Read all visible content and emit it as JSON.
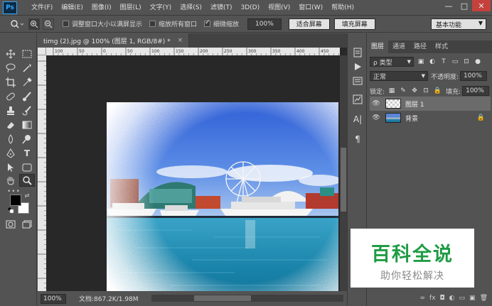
{
  "app": {
    "logo": "Ps"
  },
  "menu": [
    "文件(F)",
    "编辑(E)",
    "图像(I)",
    "图层(L)",
    "文字(Y)",
    "选择(S)",
    "滤镜(T)",
    "3D(D)",
    "视图(V)",
    "窗口(W)",
    "帮助(H)"
  ],
  "window_controls": {
    "minimize": "—",
    "maximize": "□",
    "close": "✕"
  },
  "options": {
    "tool_icon": "zoom-icon",
    "resize_windows": "调整窗口大小以满屏显示",
    "resize_windows_checked": false,
    "zoom_all": "缩放所有窗口",
    "zoom_all_checked": false,
    "scrubby": "细微缩放",
    "scrubby_checked": true,
    "zoom_value": "100%",
    "fit_screen": "适合屏幕",
    "fill_screen": "填充屏幕",
    "workspace": "基本功能"
  },
  "document": {
    "tab_title": "timg (2).jpg @ 100% (图层 1, RGB/8#) *",
    "close": "×",
    "ruler_ticks": [
      "100",
      "50",
      "0",
      "50",
      "100",
      "150",
      "200",
      "250",
      "300",
      "350",
      "400",
      "450"
    ],
    "status_zoom": "100%",
    "status_info": "文档:867.2K/1.98M"
  },
  "layers_panel": {
    "tabs": [
      "图层",
      "通道",
      "路径",
      "样式"
    ],
    "filter_label": "ρ 类型",
    "blend_mode": "正常",
    "opacity_label": "不透明度:",
    "opacity_value": "100%",
    "lock_label": "锁定:",
    "fill_label": "填充:",
    "fill_value": "100%",
    "layers": [
      {
        "name": "图层 1",
        "selected": true,
        "visible": true,
        "locked": false
      },
      {
        "name": "背景",
        "selected": false,
        "visible": true,
        "locked": true
      }
    ],
    "footer_icons": [
      "link-icon",
      "fx-icon",
      "mask-icon",
      "adjustment-icon",
      "group-icon",
      "new-layer-icon",
      "delete-icon"
    ],
    "footer_labels": [
      "∞",
      "fx",
      "◘",
      "◐",
      "▭",
      "▣",
      "🗑"
    ]
  },
  "watermark": {
    "title": "百科全说",
    "subtitle": "助你轻松解决"
  },
  "colors": {
    "panel_bg": "#535353",
    "dark": "#282828",
    "foreground": "#000000",
    "background": "#ffffff",
    "brand_green": "#1f9c44"
  }
}
